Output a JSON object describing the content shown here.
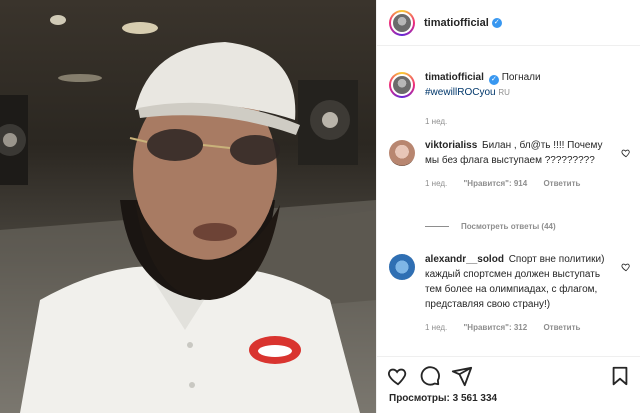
{
  "post": {
    "author": "timatiofficial",
    "caption_text": "Погнали",
    "hashtag": "#wewillROCyou",
    "lang_tag": "RU",
    "time": "1 нед.",
    "views_label": "Просмотры:",
    "views_count": "3 561 334"
  },
  "comments": [
    {
      "username": "viktoriaIiss",
      "text": "Билан , бл@ть !!!! Почему мы без флага выступаем ?????????",
      "time": "1 нед.",
      "likes": "\"Нравится\": 914",
      "reply": "Ответить",
      "view_replies": "Посмотреть ответы (44)"
    },
    {
      "username": "alexandr__solod",
      "text": "Спорт вне политики) каждый спортсмен должен выступать тем более на олимпиадах, с флагом, представляя свою страну!)",
      "time": "1 нед.",
      "likes": "\"Нравится\": 312",
      "reply": "Ответить"
    }
  ],
  "icons": [
    "verified-icon",
    "like-icon",
    "comment-icon",
    "share-icon",
    "save-icon"
  ],
  "colors": {
    "link": "#00376b",
    "verified": "#3897f0",
    "muted": "#8e8e8e"
  }
}
